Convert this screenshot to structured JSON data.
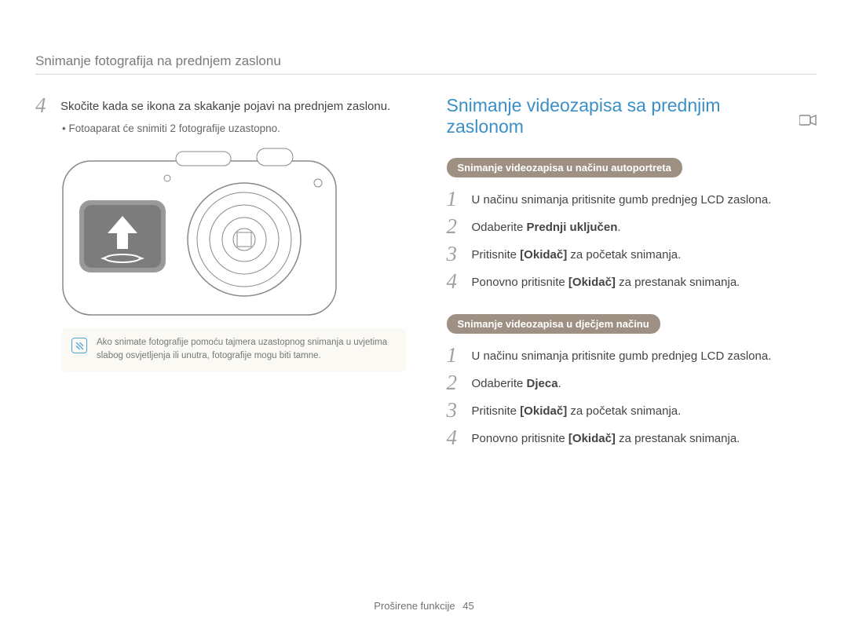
{
  "breadcrumb": "Snimanje fotografija na prednjem zaslonu",
  "left": {
    "step4_num": "4",
    "step4_text_a": "Skočite kada se ikona za skakanje pojavi na prednjem zaslonu.",
    "bullet": "Fotoaparat će snimiti 2 fotografije uzastopno.",
    "note": "Ako snimate fotografije pomoću tajmera uzastopnog snimanja u uvjetima slabog osvjetljenja ili unutra, fotografije mogu biti tamne."
  },
  "right": {
    "title": "Snimanje videozapisa sa prednjim zaslonom",
    "pill_a": "Snimanje videozapisa u načinu autoportreta",
    "a1_num": "1",
    "a1_text": "U načinu snimanja pritisnite gumb prednjeg LCD zaslona.",
    "a2_num": "2",
    "a2_text_pre": "Odaberite ",
    "a2_bold": "Prednji uključen",
    "a2_post": ".",
    "a3_num": "3",
    "a3_text_pre": "Pritisnite ",
    "a3_bold": "[Okidač]",
    "a3_post": " za početak snimanja.",
    "a4_num": "4",
    "a4_text_pre": "Ponovno pritisnite ",
    "a4_bold": "[Okidač]",
    "a4_post": " za prestanak snimanja.",
    "pill_b": "Snimanje videozapisa u dječjem načinu",
    "b1_num": "1",
    "b1_text": "U načinu snimanja pritisnite gumb prednjeg LCD zaslona.",
    "b2_num": "2",
    "b2_text_pre": "Odaberite ",
    "b2_bold": "Djeca",
    "b2_post": ".",
    "b3_num": "3",
    "b3_text_pre": "Pritisnite ",
    "b3_bold": "[Okidač]",
    "b3_post": " za početak snimanja.",
    "b4_num": "4",
    "b4_text_pre": "Ponovno pritisnite ",
    "b4_bold": "[Okidač]",
    "b4_post": " za prestanak snimanja."
  },
  "footer": {
    "section": "Proširene funkcije",
    "page": "45"
  }
}
